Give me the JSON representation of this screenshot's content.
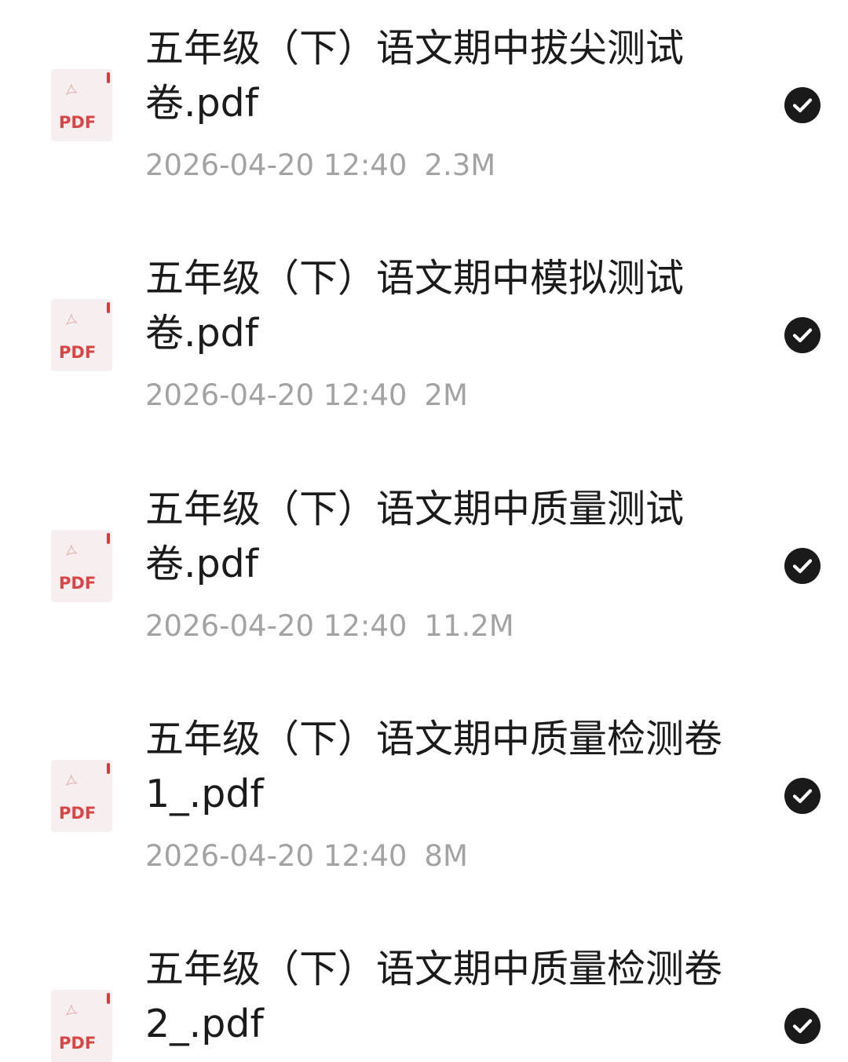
{
  "files": [
    {
      "name": "五年级（下）语文期中拔尖测试卷.pdf",
      "date": "2026-04-20 12:40",
      "size": "2.3M",
      "icon_label": "PDF",
      "icon": "pdf-file-icon",
      "selected": true
    },
    {
      "name": "五年级（下）语文期中模拟测试卷.pdf",
      "date": "2026-04-20 12:40",
      "size": "2M",
      "icon_label": "PDF",
      "icon": "pdf-file-icon",
      "selected": true
    },
    {
      "name": "五年级（下）语文期中质量测试卷.pdf",
      "date": "2026-04-20 12:40",
      "size": "11.2M",
      "icon_label": "PDF",
      "icon": "pdf-file-icon",
      "selected": true
    },
    {
      "name": "五年级（下）语文期中质量检测卷1_.pdf",
      "date": "2026-04-20 12:40",
      "size": "8M",
      "icon_label": "PDF",
      "icon": "pdf-file-icon",
      "selected": true
    },
    {
      "name": "五年级（下）语文期中质量检测卷2_.pdf",
      "date": "",
      "size": "",
      "icon_label": "PDF",
      "icon": "pdf-file-icon",
      "selected": true
    }
  ],
  "colors": {
    "name_text": "#1b1b1b",
    "meta_text": "#a3a3a3",
    "pdf_red": "#d84545",
    "check_bg": "#1a1a1a"
  }
}
